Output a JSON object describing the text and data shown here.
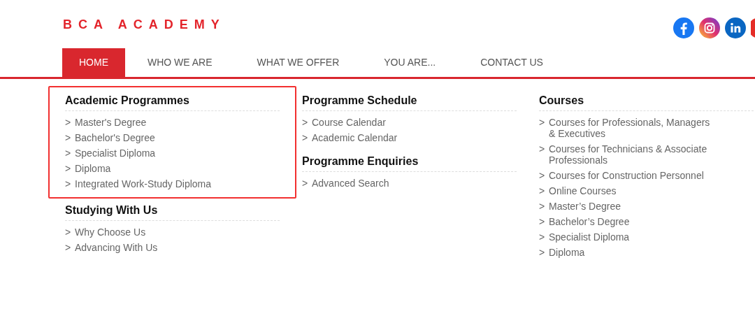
{
  "logo": "BCA ACADEMY",
  "nav": [
    {
      "label": "HOME",
      "selected": true
    },
    {
      "label": "WHO WE ARE",
      "selected": false
    },
    {
      "label": "WHAT WE OFFER",
      "selected": false
    },
    {
      "label": "YOU ARE...",
      "selected": false
    },
    {
      "label": "CONTACT US",
      "selected": false
    }
  ],
  "columns": [
    [
      {
        "title": "Academic Programmes",
        "highlighted": true,
        "links": [
          {
            "marker": ">",
            "label": "Master's Degree"
          },
          {
            "marker": ">",
            "label": "Bachelor's Degree"
          },
          {
            "marker": ">",
            "label": "Specialist Diploma"
          },
          {
            "marker": ">",
            "label": "Diploma"
          },
          {
            "marker": ">",
            "label": "Integrated Work-Study Diploma"
          }
        ]
      },
      {
        "title": "Studying With Us",
        "highlighted": false,
        "links": [
          {
            "marker": ">",
            "label": "Why Choose Us"
          },
          {
            "marker": ">",
            "label": "Advancing With Us"
          }
        ]
      }
    ],
    [
      {
        "title": "Programme Schedule",
        "highlighted": false,
        "links": [
          {
            "marker": ">",
            "label": "Course Calendar"
          },
          {
            "marker": ">",
            "label": "Academic Calendar"
          }
        ]
      },
      {
        "title": "Programme Enquiries",
        "highlighted": false,
        "links": [
          {
            "marker": ">",
            "label": "Advanced Search"
          }
        ]
      }
    ],
    [
      {
        "title": "Courses",
        "highlighted": false,
        "links": [
          {
            "marker": ">",
            "label": "Courses for Professionals, Managers & Executives"
          },
          {
            "marker": ">",
            "label": "Courses for Technicians & Associate Professionals"
          },
          {
            "marker": ">",
            "label": "Courses for Construction Personnel"
          },
          {
            "marker": ">",
            "label": "Online Courses"
          },
          {
            "marker": ">",
            "label": "Master’s Degree"
          },
          {
            "marker": ">",
            "label": "Bachelor’s Degree"
          },
          {
            "marker": ">",
            "label": "Specialist Diploma"
          },
          {
            "marker": ">",
            "label": "Diploma"
          }
        ]
      }
    ]
  ]
}
